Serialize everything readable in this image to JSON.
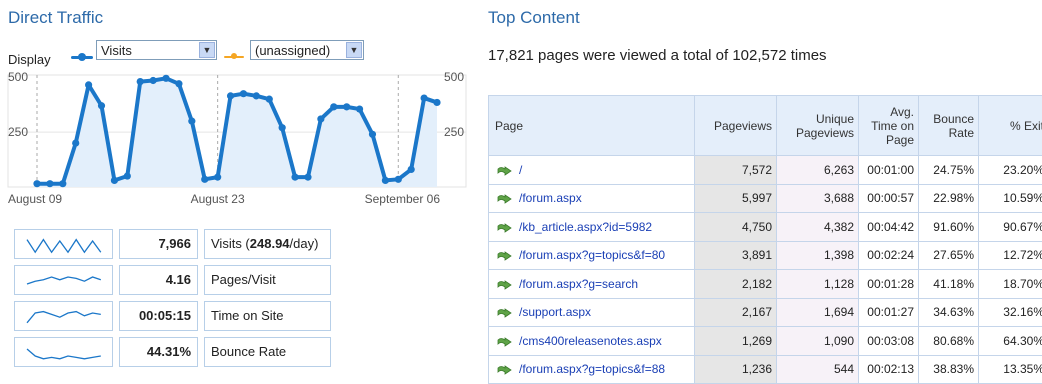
{
  "direct_traffic": {
    "title": "Direct Traffic",
    "display_label": "Display",
    "metric_select": "Visits",
    "compare_select": "(unassigned)",
    "colors": {
      "series": "#1b77c9",
      "compare": "#f5a623",
      "fill": "#e3effb"
    }
  },
  "chart_data": {
    "type": "area",
    "y_ticks_left": [
      "500",
      "250"
    ],
    "y_ticks_right": [
      "500",
      "250"
    ],
    "ylim": [
      0,
      510
    ],
    "x_labels": [
      "August 09",
      "August 23",
      "September 06"
    ],
    "x_label_index": [
      0,
      14,
      28
    ],
    "grid": true,
    "series": [
      {
        "name": "Visits",
        "values": [
          15,
          15,
          15,
          200,
          465,
          370,
          30,
          50,
          480,
          485,
          495,
          470,
          300,
          35,
          45,
          415,
          425,
          415,
          400,
          270,
          45,
          45,
          310,
          365,
          365,
          355,
          240,
          30,
          35,
          80,
          405,
          385
        ]
      }
    ]
  },
  "metrics": [
    {
      "value": "7,966",
      "label_pre": "Visits (",
      "label_bold": "248.94",
      "label_post": "/day)"
    },
    {
      "value": "4.16",
      "label_pre": "Pages/Visit",
      "label_bold": "",
      "label_post": ""
    },
    {
      "value": "00:05:15",
      "label_pre": "Time on Site",
      "label_bold": "",
      "label_post": ""
    },
    {
      "value": "44.31%",
      "label_pre": "Bounce Rate",
      "label_bold": "",
      "label_post": ""
    }
  ],
  "top_content": {
    "title": "Top Content",
    "summary": "17,821 pages were viewed a total of 102,572 times",
    "columns": [
      "Page",
      "Pageviews",
      "Unique Pageviews",
      "Avg. Time on Page",
      "Bounce Rate",
      "% Exit"
    ],
    "rows": [
      [
        "/",
        "7,572",
        "6,263",
        "00:01:00",
        "24.75%",
        "23.20%"
      ],
      [
        "/forum.aspx",
        "5,997",
        "3,688",
        "00:00:57",
        "22.98%",
        "10.59%"
      ],
      [
        "/kb_article.aspx?id=5982",
        "4,750",
        "4,382",
        "00:04:42",
        "91.60%",
        "90.67%"
      ],
      [
        "/forum.aspx?g=topics&f=80",
        "3,891",
        "1,398",
        "00:02:24",
        "27.65%",
        "12.72%"
      ],
      [
        "/forum.aspx?g=search",
        "2,182",
        "1,128",
        "00:01:28",
        "41.18%",
        "18.70%"
      ],
      [
        "/support.aspx",
        "2,167",
        "1,694",
        "00:01:27",
        "34.63%",
        "32.16%"
      ],
      [
        "/cms400releasenotes.aspx",
        "1,269",
        "1,090",
        "00:03:08",
        "80.68%",
        "64.30%"
      ],
      [
        "/forum.aspx?g=topics&f=88",
        "1,236",
        "544",
        "00:02:13",
        "38.83%",
        "13.35%"
      ]
    ]
  }
}
